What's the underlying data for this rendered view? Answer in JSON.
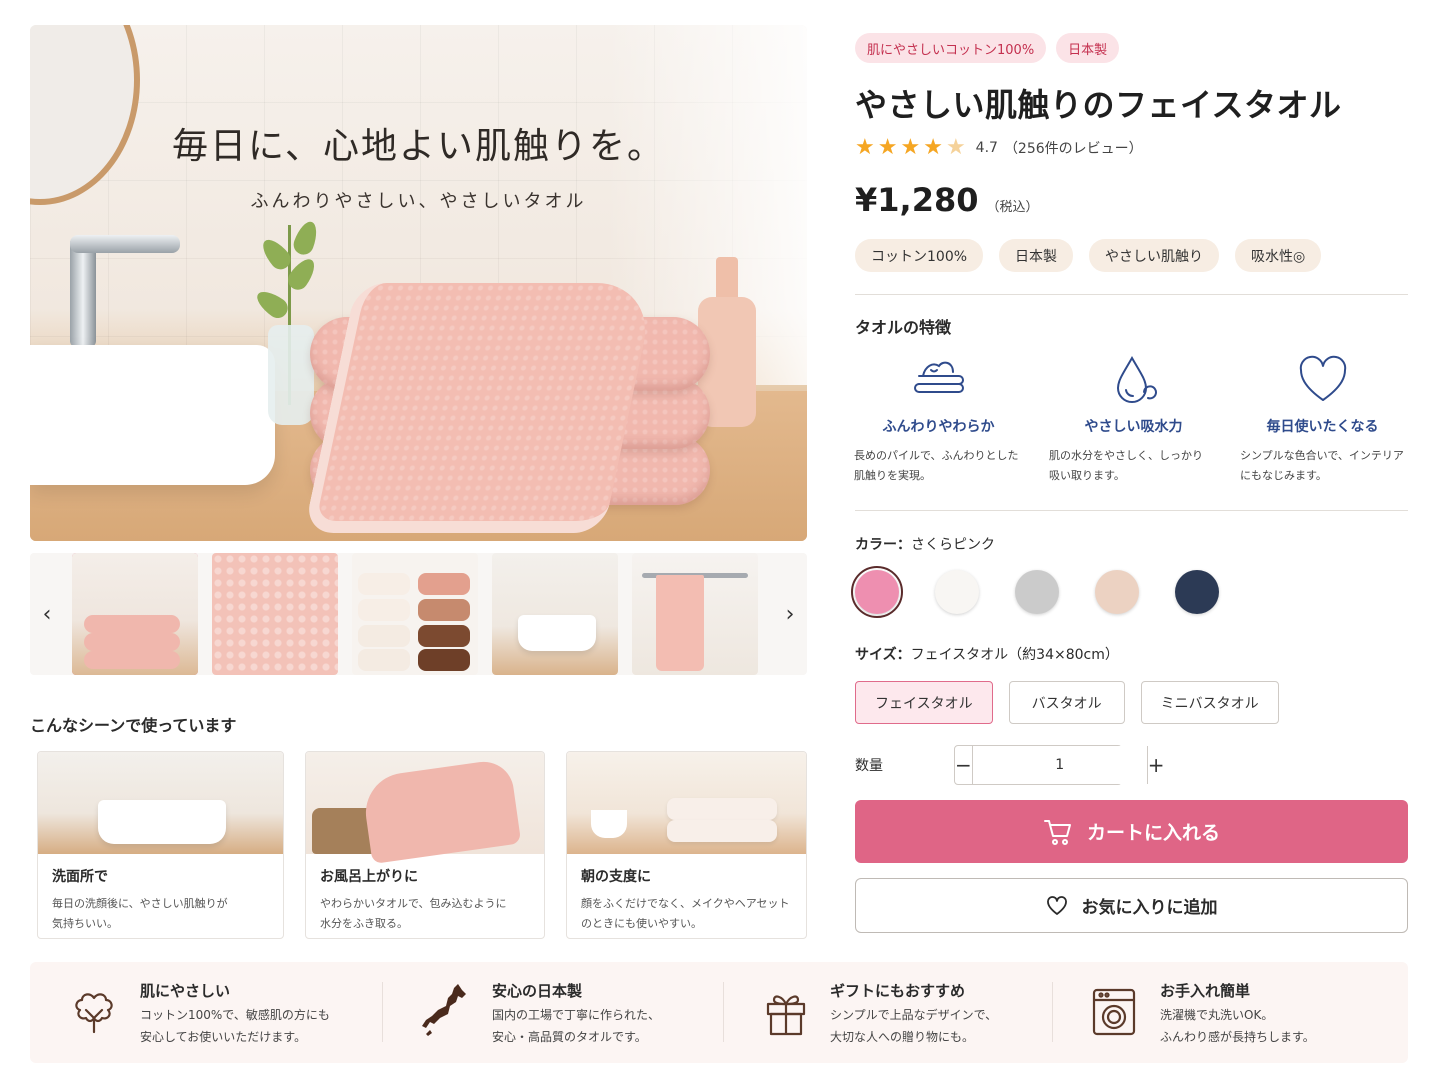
{
  "hero": {
    "title": "毎日に、心地よい肌触りを。",
    "subtitle": "ふんわりやさしい、やさしいタオル"
  },
  "thumbnails": {
    "prev_label": "‹",
    "next_label": "›"
  },
  "scenes": {
    "title": "こんなシーンで使っています",
    "items": [
      {
        "title": "洗面所で",
        "text_1": "毎日の洗顔後に、やさしい肌触りが",
        "text_2": "気持ちいい。"
      },
      {
        "title": "お風呂上がりに",
        "text_1": "やわらかいタオルで、包み込むように",
        "text_2": "水分をふき取る。"
      },
      {
        "title": "朝の支度に",
        "text_1": "顔をふくだけでなく、メイクやヘアセット",
        "text_2": "のときにも使いやすい。"
      }
    ]
  },
  "badges": [
    "肌にやさしいコットン100%",
    "日本製"
  ],
  "product": {
    "title": "やさしい肌触りのフェイスタオル",
    "rating_value": "4.7",
    "rating_count": "（256件のレビュー）",
    "rating": 4.7,
    "price": "¥1,280",
    "price_tax": "（税込）"
  },
  "tags": [
    "コットン100%",
    "日本製",
    "やさしい肌触り",
    "吸水性◎"
  ],
  "features": {
    "title": "タオルの特徴",
    "items": [
      {
        "icon": "soft-pile-icon",
        "title": "ふんわりやわらか",
        "text_1": "長めのパイルで、ふんわりとした",
        "text_2": "肌触りを実現。"
      },
      {
        "icon": "water-drop-icon",
        "title": "やさしい吸水力",
        "text_1": "肌の水分をやさしく、しっかり",
        "text_2": "吸い取ります。"
      },
      {
        "icon": "heart-icon",
        "title": "毎日使いたくなる",
        "text_1": "シンプルな色合いで、インテリア",
        "text_2": "にもなじみます。"
      }
    ]
  },
  "color": {
    "label": "カラー：",
    "value": "さくらピンク",
    "swatches": [
      "#ee8fb0",
      "#f8f6f3",
      "#cbcbcb",
      "#ecd2c2",
      "#2c3a55"
    ],
    "selected_index": 0
  },
  "size": {
    "label": "サイズ：",
    "value": "フェイスタオル（約34×80cm）",
    "options": [
      "フェイスタオル",
      "バスタオル",
      "ミニバスタオル"
    ],
    "selected_index": 0
  },
  "quantity": {
    "label": "数量",
    "minus": "−",
    "value": "1",
    "plus": "+"
  },
  "actions": {
    "cart_label": "カートに入れる",
    "favorite_label": "お気に入りに追加"
  },
  "benefits": [
    {
      "icon": "cotton-icon",
      "title": "肌にやさしい",
      "text_1": "コットン100%で、敏感肌の方にも",
      "text_2": "安心してお使いいただけます。"
    },
    {
      "icon": "japan-map-icon",
      "title": "安心の日本製",
      "text_1": "国内の工場で丁寧に作られた、",
      "text_2": "安心・高品質のタオルです。"
    },
    {
      "icon": "gift-icon",
      "title": "ギフトにもおすすめ",
      "text_1": "シンプルで上品なデザインで、",
      "text_2": "大切な人への贈り物にも。"
    },
    {
      "icon": "washing-machine-icon",
      "title": "お手入れ簡単",
      "text_1": "洗濯機で丸洗いOK。",
      "text_2": "ふんわり感が長持ちします。"
    }
  ],
  "colors": {
    "accent": "#df6586",
    "badge_text": "#c4304f",
    "feature_title": "#2f4b8c",
    "star": "#f5a623"
  }
}
